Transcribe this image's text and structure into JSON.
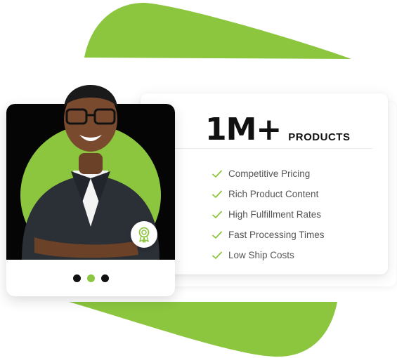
{
  "colors": {
    "accent": "#8cc63f",
    "dark": "#111111",
    "text": "#555555"
  },
  "headline": {
    "number": "1M+",
    "unit": "PRODUCTS"
  },
  "features": [
    {
      "label": "Competitive Pricing",
      "icon": "check-icon"
    },
    {
      "label": "Rich Product Content",
      "icon": "check-icon"
    },
    {
      "label": "High Fulfillment Rates",
      "icon": "check-icon"
    },
    {
      "label": "Fast Processing Times",
      "icon": "check-icon"
    },
    {
      "label": "Low Ship Costs",
      "icon": "check-icon"
    }
  ],
  "carousel": {
    "slides": 3,
    "active_index": 1
  },
  "badge": {
    "icon": "award-ribbon-icon"
  },
  "photo": {
    "subject": "smiling-man-portrait"
  }
}
